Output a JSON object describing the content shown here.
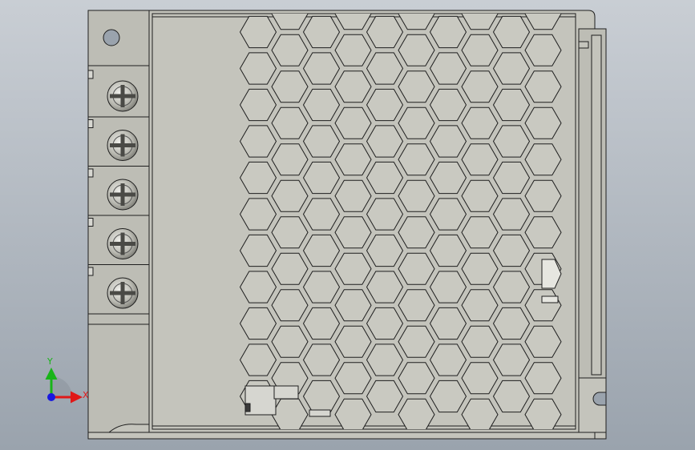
{
  "viewport": {
    "background_top": "#c9ced4",
    "background_bottom": "#9aa3ad"
  },
  "model": {
    "body_fill": "#c4c4bc",
    "panel_fill": "#bdbdb5",
    "edge_color": "#1e1e1e",
    "hex_fill": "#c9c9c1",
    "terminal_screws": 5,
    "hex_columns": 10,
    "hex_rows": 11
  },
  "triad": {
    "x_label": "X",
    "y_label": "Y",
    "x_color": "#e01818",
    "y_color": "#18b418",
    "z_color": "#1818e0"
  }
}
